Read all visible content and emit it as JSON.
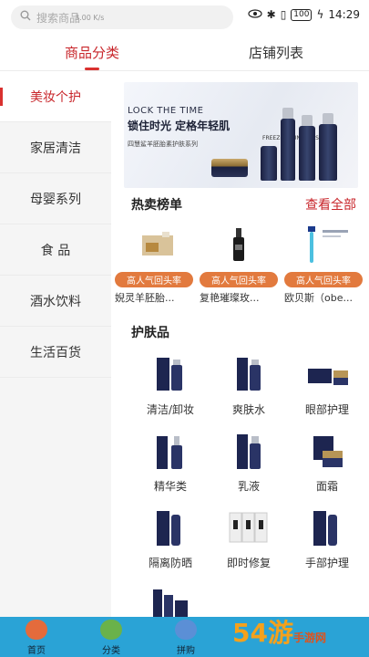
{
  "status_bar": {
    "search_placeholder": "搜索商品",
    "wifi_speed": "3.00 K/s",
    "battery": "100",
    "time": "14:29"
  },
  "tabs": [
    {
      "label": "商品分类",
      "active": true
    },
    {
      "label": "店铺列表",
      "active": false
    }
  ],
  "sidebar": {
    "items": [
      {
        "label": "美妆个护",
        "active": true
      },
      {
        "label": "家居清洁",
        "active": false
      },
      {
        "label": "母婴系列",
        "active": false
      },
      {
        "label": "食 品",
        "active": false
      },
      {
        "label": "酒水饮料",
        "active": false
      },
      {
        "label": "生活百货",
        "active": false
      }
    ]
  },
  "banner": {
    "title_en": "LOCK THE TIME",
    "title_cn": "锁住时光 定格年轻肌",
    "tagline_en": "FREEZE YOUNG MUSCLE",
    "subtitle": "四慧鲨羊胚胎素护肤系列"
  },
  "hot_list": {
    "title": "热卖榜单",
    "see_all": "查看全部",
    "items": [
      {
        "badge": "高人气回头率",
        "name": "婗灵羊胚胎..."
      },
      {
        "badge": "高人气回头率",
        "name": "复艳璀璨玫..."
      },
      {
        "badge": "高人气回头率",
        "name": "欧贝斯（obe..."
      }
    ]
  },
  "skincare": {
    "title": "护肤品",
    "categories": [
      {
        "label": "清洁/卸妆"
      },
      {
        "label": "爽肤水"
      },
      {
        "label": "眼部护理"
      },
      {
        "label": "精华类"
      },
      {
        "label": "乳液"
      },
      {
        "label": "面霜"
      },
      {
        "label": "隔离防晒"
      },
      {
        "label": "即时修复"
      },
      {
        "label": "手部护理"
      }
    ]
  },
  "bottom_nav": {
    "items": [
      {
        "label": "首页",
        "icon": "home-icon"
      },
      {
        "label": "分类",
        "icon": "category-icon"
      },
      {
        "label": "拼购",
        "icon": "group-buy-icon"
      }
    ]
  },
  "watermark": {
    "text": "54游",
    "sub": "手游网"
  },
  "colors": {
    "accent": "#c8262b",
    "badge": "#e27a3e",
    "tabbar": "#2aa3d6"
  }
}
